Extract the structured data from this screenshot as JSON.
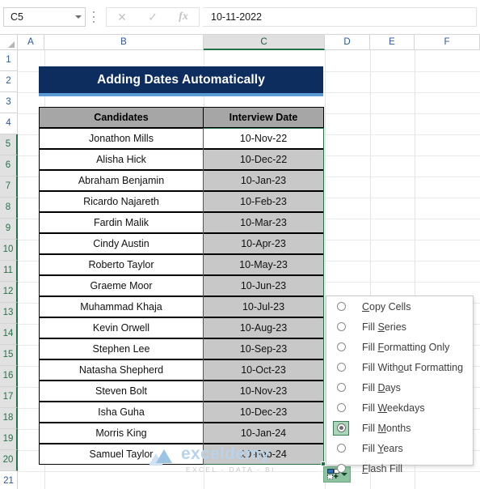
{
  "formula_bar": {
    "name_box_value": "C5",
    "formula_value": "10-11-2022",
    "cancel_icon": "close-icon",
    "enter_icon": "check-icon",
    "fx_label": "fx"
  },
  "grid": {
    "columns": [
      "A",
      "B",
      "C",
      "D",
      "E",
      "F"
    ],
    "active_column": "C",
    "rows": [
      "1",
      "2",
      "3",
      "4",
      "5",
      "6",
      "7",
      "8",
      "9",
      "10",
      "11",
      "12",
      "13",
      "14",
      "15",
      "16",
      "17",
      "18",
      "19",
      "20",
      "21"
    ],
    "selected_rows": [
      "5",
      "6",
      "7",
      "8",
      "9",
      "10",
      "11",
      "12",
      "13",
      "14",
      "15",
      "16",
      "17",
      "18",
      "19",
      "20"
    ]
  },
  "sheet": {
    "title": "Adding Dates Automatically",
    "headers": [
      "Candidates",
      "Interview Date"
    ],
    "rows": [
      {
        "candidate": "Jonathon Mills",
        "date": "10-Nov-22"
      },
      {
        "candidate": "Alisha Hick",
        "date": "10-Dec-22"
      },
      {
        "candidate": "Abraham Benjamin",
        "date": "10-Jan-23"
      },
      {
        "candidate": "Ricardo Najareth",
        "date": "10-Feb-23"
      },
      {
        "candidate": "Fardin Malik",
        "date": "10-Mar-23"
      },
      {
        "candidate": "Cindy Austin",
        "date": "10-Apr-23"
      },
      {
        "candidate": "Roberto Taylor",
        "date": "10-May-23"
      },
      {
        "candidate": "Graeme Moor",
        "date": "10-Jun-23"
      },
      {
        "candidate": "Muhammad Khaja",
        "date": "10-Jul-23"
      },
      {
        "candidate": "Kevin Orwell",
        "date": "10-Aug-23"
      },
      {
        "candidate": "Stephen Lee",
        "date": "10-Sep-23"
      },
      {
        "candidate": "Natasha Shepherd",
        "date": "10-Oct-23"
      },
      {
        "candidate": "Steven Bolt",
        "date": "10-Nov-23"
      },
      {
        "candidate": "Isha Guha",
        "date": "10-Dec-23"
      },
      {
        "candidate": "Morris King",
        "date": "10-Jan-24"
      },
      {
        "candidate": "Samuel Taylor",
        "date": "10-Feb-24"
      }
    ]
  },
  "autofill": {
    "button_label": "Auto Fill Options",
    "selected_option": "Fill Months",
    "options": [
      {
        "label": "Copy Cells",
        "accel": "C",
        "pre": "",
        "post": "opy Cells",
        "checked": false
      },
      {
        "label": "Fill Series",
        "accel": "S",
        "pre": "Fill ",
        "post": "eries",
        "checked": false
      },
      {
        "label": "Fill Formatting Only",
        "accel": "F",
        "pre": "Fill ",
        "post": "ormatting Only",
        "checked": false
      },
      {
        "label": "Fill Without Formatting",
        "accel": "o",
        "pre": "Fill With",
        "post": "ut Formatting",
        "checked": false
      },
      {
        "label": "Fill Days",
        "accel": "D",
        "pre": "Fill ",
        "post": "ays",
        "checked": false
      },
      {
        "label": "Fill Weekdays",
        "accel": "W",
        "pre": "Fill ",
        "post": "eekdays",
        "checked": false
      },
      {
        "label": "Fill Months",
        "accel": "M",
        "pre": "Fill ",
        "post": "onths",
        "checked": true
      },
      {
        "label": "Fill Years",
        "accel": "Y",
        "pre": "Fill ",
        "post": "ears",
        "checked": false
      },
      {
        "label": "Flash Fill",
        "accel": "F",
        "pre": "",
        "post": "lash Fill",
        "checked": false
      }
    ]
  },
  "watermark": {
    "name": "exceldemy",
    "tagline": "EXCEL - DATA - BI"
  },
  "colors": {
    "title_bg": "#0d2d5e",
    "title_underline": "#5b9bd5",
    "header_bg": "#a6a6a6",
    "selection_green": "#217346",
    "shaded_cell": "#c8c8c8"
  }
}
